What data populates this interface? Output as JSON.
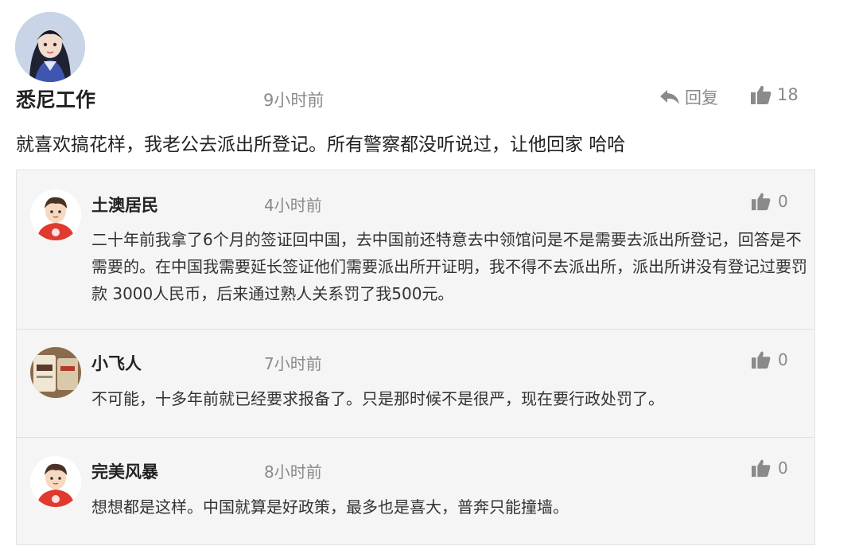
{
  "post": {
    "author": "悉尼工作",
    "time": "9小时前",
    "reply_label": "回复",
    "likes": "18",
    "text": "就喜欢搞花样，我老公去派出所登记。所有警察都没听说过，让他回家 哈哈"
  },
  "replies": [
    {
      "author": "土澳居民",
      "time": "4小时前",
      "likes": "0",
      "text": "二十年前我拿了6个月的签证回中国，去中国前还特意去中领馆问是不是需要去派出所登记，回答是不需要的。在中国我需要延长签证他们需要派出所开证明，我不得不去派出所，派出所讲没有登记过要罚款 3000人民币，后来通过熟人关系罚了我500元。"
    },
    {
      "author": "小飞人",
      "time": "7小时前",
      "likes": "0",
      "text": "不可能，十多年前就已经要求报备了。只是那时候不是很严，现在要行政处罚了。"
    },
    {
      "author": "完美风暴",
      "time": "8小时前",
      "likes": "0",
      "text": "想想都是这样。中国就算是好政策，最多也是喜大，普奔只能撞墙。"
    }
  ],
  "icons": {
    "reply": "reply-arrow-icon",
    "like": "thumbs-up-icon"
  },
  "colors": {
    "muted": "#8a8a8a",
    "reply_bg": "#f5f5f5",
    "avatar_red": "#e03a2f"
  }
}
